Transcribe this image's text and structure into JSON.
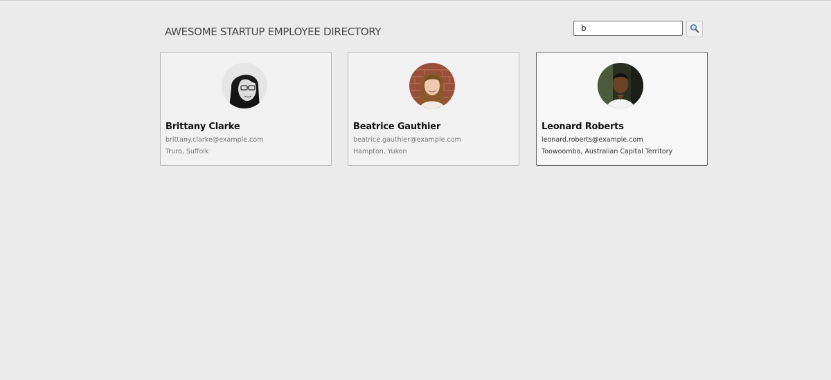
{
  "header": {
    "title": "AWESOME STARTUP EMPLOYEE DIRECTORY"
  },
  "search": {
    "value": "b",
    "button_icon": "search-icon"
  },
  "employees": [
    {
      "name": "Brittany Clarke",
      "email": "brittany.clarke@example.com",
      "location": "Truro, Suffolk",
      "avatar_icon": "avatar-photo",
      "highlighted": false
    },
    {
      "name": "Beatrice Gauthier",
      "email": "beatrice.gauthier@example.com",
      "location": "Hampton, Yukon",
      "avatar_icon": "avatar-photo",
      "highlighted": false
    },
    {
      "name": "Leonard Roberts",
      "email": "leonard.roberts@example.com",
      "location": "Toowoomba, Australian Capital Territory",
      "avatar_icon": "avatar-photo",
      "highlighted": true
    }
  ],
  "colors": {
    "background": "#ebebeb",
    "card_background": "#f2f2f2",
    "card_border": "#b9b9b9",
    "card_border_highlight": "#666666",
    "title_text": "#4a4a4a",
    "secondary_text": "#777777"
  }
}
